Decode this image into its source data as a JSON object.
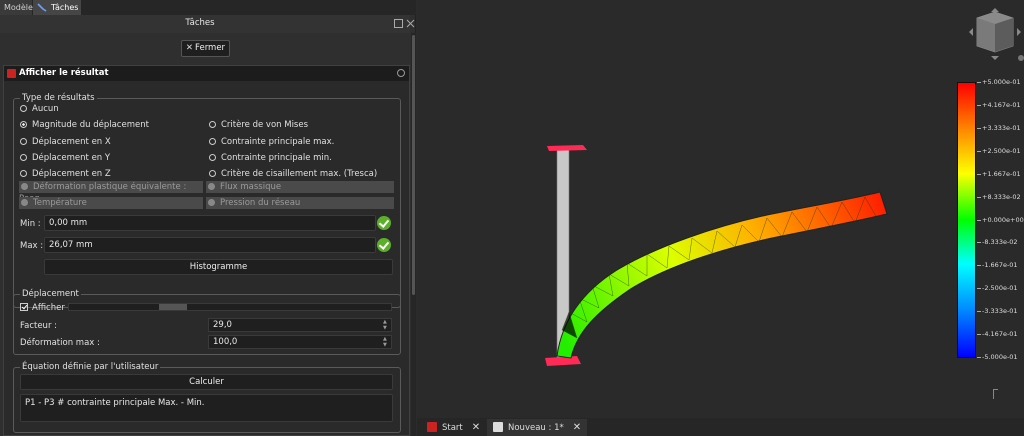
{
  "tabs": {
    "model": "Modèle",
    "tasks": "Tâches"
  },
  "panel": {
    "title": "Tâches",
    "close_label": "Fermer"
  },
  "result": {
    "title": "Afficher le résultat",
    "type_group": "Type de résultats",
    "radios": {
      "none": "Aucun",
      "disp_mag": "Magnitude du déplacement",
      "disp_x": "Déplacement en X",
      "disp_y": "Déplacement en Y",
      "disp_z": "Déplacement en Z",
      "von_mises": "Critère de von Mises",
      "max_principal": "Contrainte principale max.",
      "min_principal": "Contrainte principale min.",
      "tresca": "Critère de cisaillement max. (Tresca)",
      "peeq": "Déformation plastique équivalente : Peeq",
      "mass_flow": "Flux massique",
      "temperature": "Température",
      "network_pressure": "Pression du réseau"
    },
    "min_label": "Min :",
    "min_value": "0,00 mm",
    "max_label": "Max :",
    "max_value": "26,07 mm",
    "histogram_label": "Histogramme",
    "displacement_group": "Déplacement",
    "show_label": "Afficher",
    "factor_label": "Facteur :",
    "factor_value": "29,0",
    "max_deform_label": "Déformation max :",
    "max_deform_value": "100,0",
    "equation_group": "Équation définie par l'utilisateur",
    "compute_label": "Calculer",
    "equation_text": "P1 - P3 # contrainte principale Max. - Min."
  },
  "legend": {
    "ticks": [
      "+5.000e-01",
      "+4.167e-01",
      "+3.333e-01",
      "+2.500e-01",
      "+1.667e-01",
      "+8.333e-02",
      "+0.000e+00",
      "-8.333e-02",
      "-1.667e-01",
      "-2.500e-01",
      "-3.333e-01",
      "-4.167e-01",
      "-5.000e-01"
    ],
    "colors": {
      "top": "#ff0000",
      "mid": "#00ff00",
      "bottom": "#0000ff"
    }
  },
  "bottom_tabs": {
    "start": "Start",
    "doc": "Nouveau : 1*"
  },
  "icons": [
    "close-icon",
    "freecad-logo-icon",
    "check-icon",
    "nav-cube-icon",
    "collapse-icon"
  ]
}
